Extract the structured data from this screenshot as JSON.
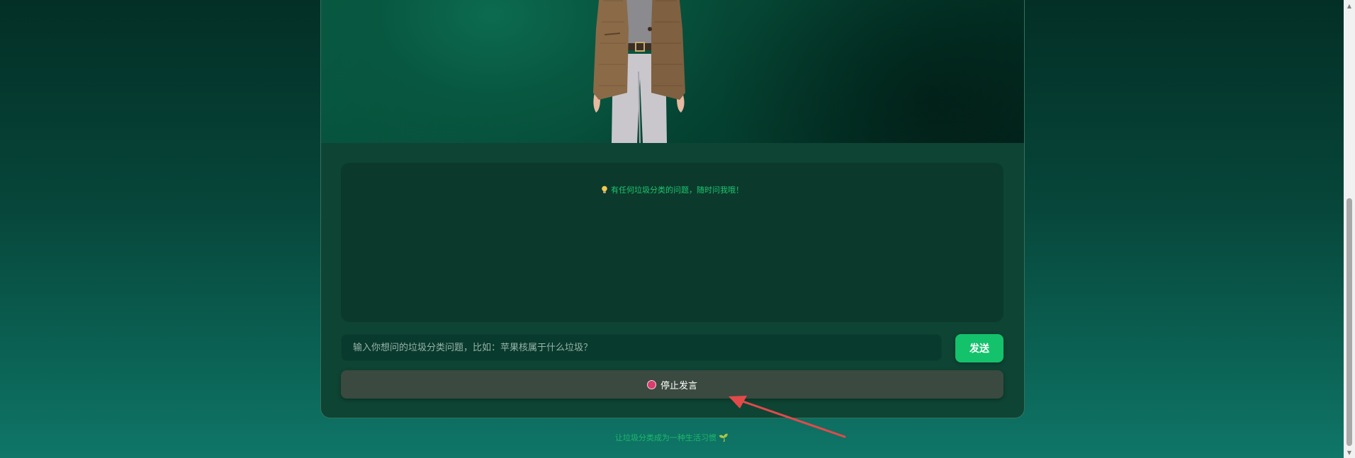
{
  "chat": {
    "hint": "有任何垃圾分类的问题，随时问我哦！",
    "input_placeholder": "输入你想问的垃圾分类问题，比如：苹果核属于什么垃圾？",
    "send_label": "发送",
    "stop_label": "停止发言"
  },
  "footer": {
    "text": "让垃圾分类成为一种生活习惯 🌱"
  },
  "colors": {
    "accent": "#14c26c",
    "hint_text": "#1ec46f",
    "stop_dot": "#d93c6f",
    "annotation_arrow": "#e24a4a"
  },
  "icons": [
    "bulb-icon",
    "stop-record-icon",
    "annotation-arrow",
    "scroll-up-icon",
    "scroll-down-icon"
  ]
}
